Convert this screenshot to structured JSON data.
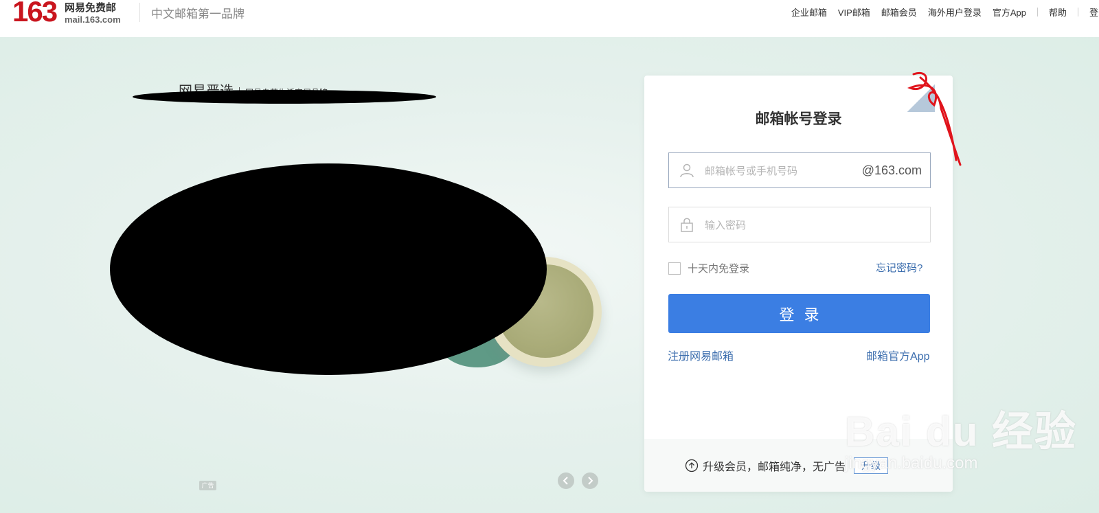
{
  "header": {
    "logo_number": "163",
    "logo_cn": "网易免费邮",
    "logo_domain": "mail.163.com",
    "slogan": "中文邮箱第一品牌",
    "nav": [
      "企业邮箱",
      "VIP邮箱",
      "邮箱会员",
      "海外用户登录",
      "官方App",
      "帮助",
      "登录"
    ]
  },
  "banner": {
    "brand_logo": "网易严选",
    "brand_slogan": "网易自营生活家居品牌",
    "ad_label": "广告",
    "prev_icon": "chevron-left-icon",
    "next_icon": "chevron-right-icon"
  },
  "login": {
    "title": "邮箱帐号登录",
    "account_placeholder": "邮箱帐号或手机号码",
    "domain_suffix": "@163.com",
    "password_placeholder": "输入密码",
    "remember_label": "十天内免登录",
    "forgot_label": "忘记密码?",
    "submit_label": "登录",
    "register_link": "注册网易邮箱",
    "app_link": "邮箱官方App"
  },
  "footer": {
    "upgrade_text": "升级会员，邮箱纯净，无广告",
    "upgrade_button": "升级"
  },
  "watermark": {
    "main": "Bai du 经验",
    "sub": "jingyan.baidu.com"
  },
  "colors": {
    "brand_red": "#c9151e",
    "accent_blue": "#3b7ee3",
    "link_blue": "#3c6eae",
    "background_mint": "#dcede6"
  }
}
